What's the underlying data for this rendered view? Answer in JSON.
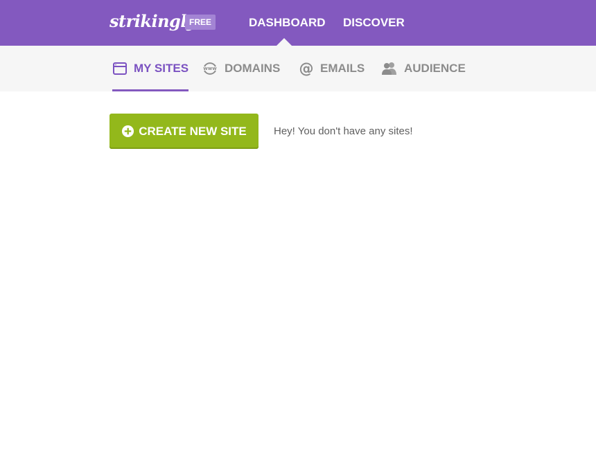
{
  "header": {
    "logo": "strikingly",
    "plan_badge": "FREE",
    "nav": [
      {
        "label": "DASHBOARD",
        "active": true
      },
      {
        "label": "DISCOVER",
        "active": false
      }
    ]
  },
  "subnav": {
    "tabs": [
      {
        "label": "MY SITES",
        "icon": "browser-window-icon",
        "active": true
      },
      {
        "label": "DOMAINS",
        "icon": "www-icon",
        "active": false
      },
      {
        "label": "EMAILS",
        "icon": "at-sign-icon",
        "active": false
      },
      {
        "label": "AUDIENCE",
        "icon": "people-icon",
        "active": false
      }
    ]
  },
  "main": {
    "create_button_label": "CREATE NEW SITE",
    "create_button_icon": "plus-circle-icon",
    "empty_message": "Hey! You don't have any sites!"
  },
  "colors": {
    "brand_purple": "#8359bf",
    "active_tab": "#7b52c1",
    "create_green": "#93b81b"
  }
}
